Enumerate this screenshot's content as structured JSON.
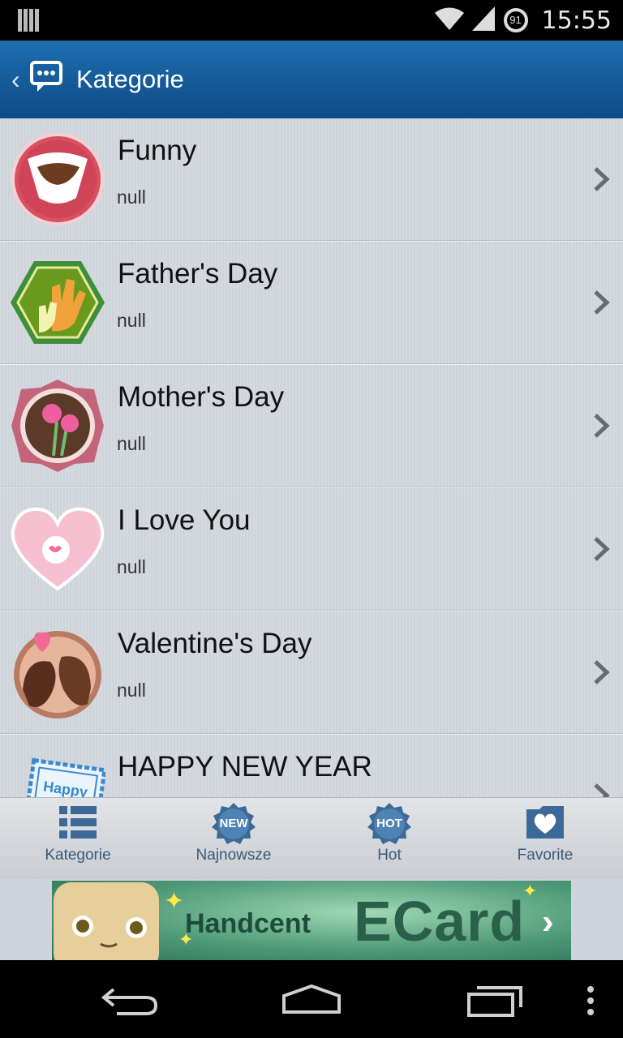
{
  "status_bar": {
    "time": "15:55",
    "battery_level": "91"
  },
  "app_bar": {
    "title": "Kategorie"
  },
  "categories": [
    {
      "name": "Funny",
      "subtitle": "null",
      "icon": "laughing-mouth-icon"
    },
    {
      "name": "Father's Day",
      "subtitle": "null",
      "icon": "hands-hexagon-icon"
    },
    {
      "name": "Mother's Day",
      "subtitle": "null",
      "icon": "carnation-badge-icon"
    },
    {
      "name": "I Love You",
      "subtitle": "null",
      "icon": "love-heart-icon"
    },
    {
      "name": "Valentine's Day",
      "subtitle": "null",
      "icon": "kissing-couple-icon"
    },
    {
      "name": "HAPPY NEW YEAR",
      "subtitle": "",
      "icon": "happy-new-year-card-icon"
    }
  ],
  "tabs": [
    {
      "label": "Kategorie",
      "icon": "list-icon"
    },
    {
      "label": "Najnowsze",
      "icon": "new-badge-icon",
      "badge": "NEW"
    },
    {
      "label": "Hot",
      "icon": "hot-badge-icon",
      "badge": "HOT"
    },
    {
      "label": "Favorite",
      "icon": "heart-folder-icon"
    }
  ],
  "ad": {
    "brand": "Handcent",
    "product": "ECard"
  },
  "colors": {
    "app_bar": "#1a62a3",
    "tab_label": "#3b5a7c",
    "list_bg": "#d3d7de"
  }
}
